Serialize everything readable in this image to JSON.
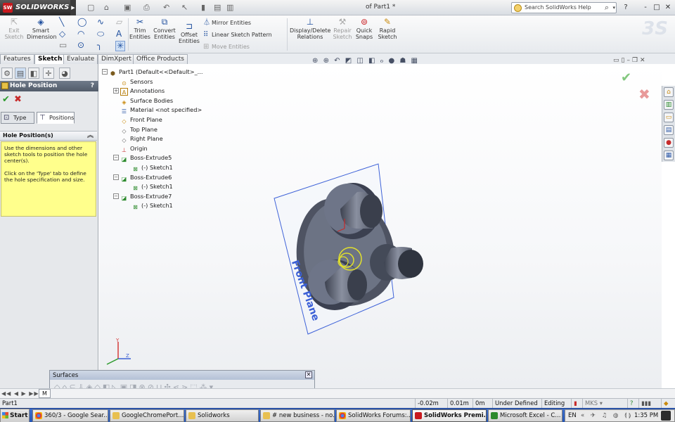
{
  "app": {
    "name": "SOLIDWORKS",
    "logo_mark": "SW",
    "doc_title": "of Part1 *"
  },
  "search": {
    "placeholder": "Search SolidWorks Help"
  },
  "title_buttons": {
    "help": "?",
    "minimize": "-",
    "restore": "□",
    "close": "✕"
  },
  "commands": {
    "exit_sketch": "Exit Sketch",
    "smart_dimension": "Smart Dimension",
    "trim_entities": "Trim Entities",
    "convert_entities": "Convert Entities",
    "offset_entities": "Offset Entities",
    "mirror_entities": "Mirror Entities",
    "linear_sketch_pattern": "Linear Sketch Pattern",
    "move_entities": "Move Entities",
    "display_delete_relations": "Display/Delete Relations",
    "repair_sketch": "Repair Sketch",
    "quick_snaps": "Quick Snaps",
    "rapid_sketch": "Rapid Sketch"
  },
  "tabs": [
    "Features",
    "Sketch",
    "Evaluate",
    "DimXpert",
    "Office Products"
  ],
  "active_tab": "Sketch",
  "property_manager": {
    "title": "Hole Position",
    "help": "?",
    "tab_type": "Type",
    "tab_positions": "Positions",
    "group_title": "Hole Position(s)",
    "text1": "Use the dimensions and other sketch tools to position the hole center(s).",
    "text2": "Click on the 'Type' tab to define the hole specification and size."
  },
  "feature_tree": {
    "root": "Part1  (Default<<Default>_...",
    "items": [
      "Sensors",
      "Annotations",
      "Surface Bodies",
      "Material <not specified>",
      "Front Plane",
      "Top Plane",
      "Right Plane",
      "Origin",
      "Boss-Extrude5",
      "(-) Sketch1",
      "Boss-Extrude6",
      "(-) Sketch1",
      "Boss-Extrude7",
      "(-) Sketch1"
    ]
  },
  "viewport": {
    "plane_label": "Front Plane"
  },
  "surfaces_toolbar": {
    "title": "Surfaces",
    "close": "✕"
  },
  "model_tab": "M",
  "status": {
    "part": "Part1",
    "x": "-0.02m",
    "y": "0.01m",
    "z": "0m",
    "sketch_state": "Under Defined",
    "mode": "Editing",
    "units": "MKS"
  },
  "taskbar": {
    "start": "Start",
    "items": [
      "360/3 - Google Sear...",
      "GoogleChromePort...",
      "Solidworks",
      "# new business - no...",
      "SolidWorks Forums:...",
      "SolidWorks Premi...",
      "Microsoft Excel - C..."
    ],
    "active_item": "SolidWorks Premi...",
    "lang": "EN",
    "clock": "1:35 PM"
  },
  "colors": {
    "accent": "#2456b6",
    "brand_red": "#c8191e",
    "part_steel": "#6c7384",
    "tooltip_yellow": "#ffff8c"
  }
}
